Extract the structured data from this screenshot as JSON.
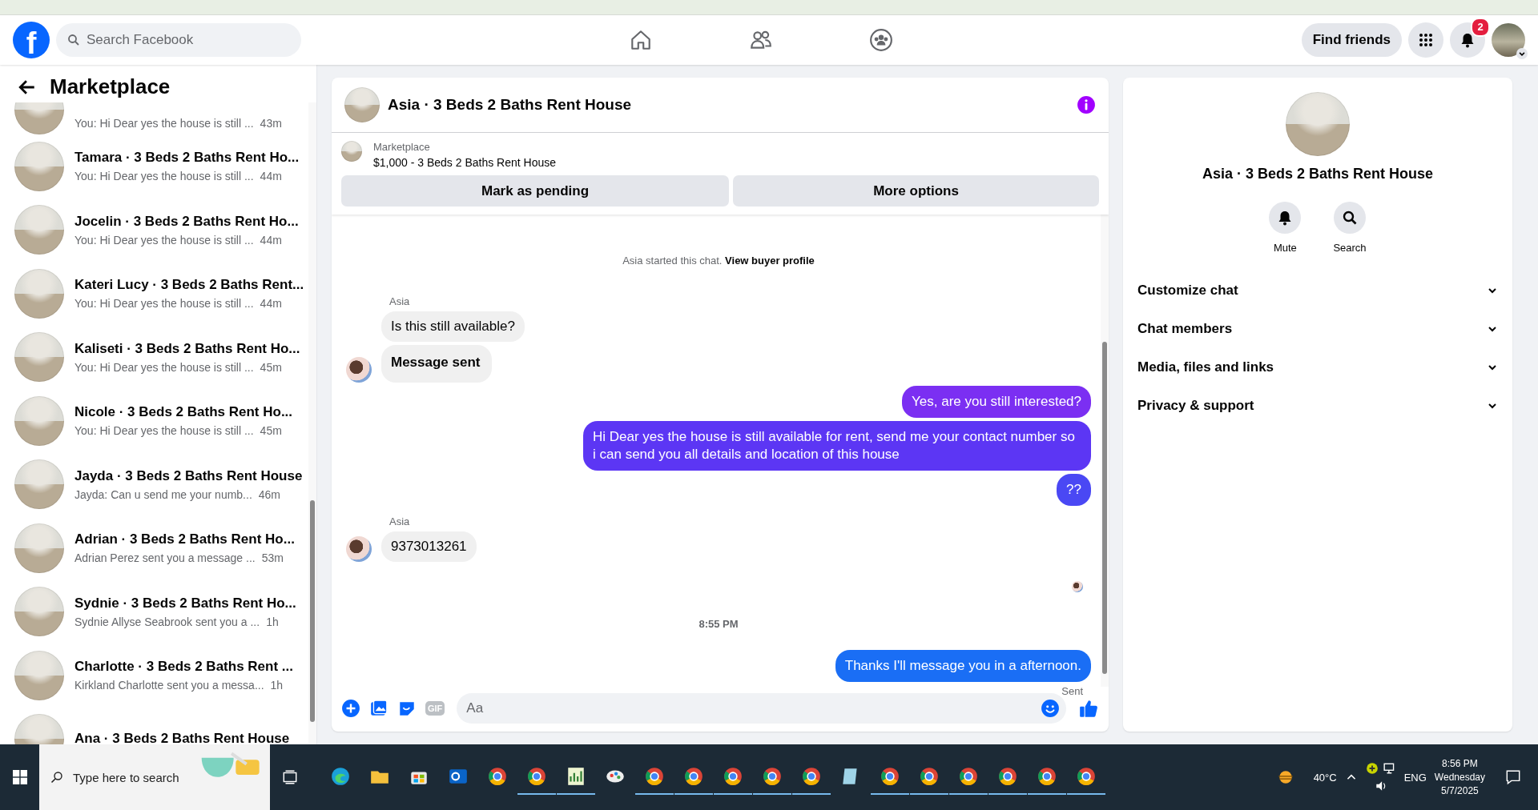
{
  "nav": {
    "logo": "f",
    "search": {
      "placeholder": "Search Facebook"
    },
    "tabs": [
      {
        "kind": "home",
        "selected": false
      },
      {
        "kind": "friends",
        "selected": false
      },
      {
        "kind": "groups",
        "selected": false
      }
    ],
    "find_friends": "Find friends",
    "notifications_badge": "2"
  },
  "sidebar": {
    "title": "Marketplace",
    "items": [
      {
        "preview": "You: Hi Dear yes the house is still ...",
        "time": "43m"
      },
      {
        "name": "Tamara · 3 Beds 2 Baths Rent Ho...",
        "preview": "You: Hi Dear yes the house is still ...",
        "time": "44m"
      },
      {
        "name": "Jocelin · 3 Beds 2 Baths Rent Ho...",
        "preview": "You: Hi Dear yes the house is still ...",
        "time": "44m"
      },
      {
        "name": "Kateri Lucy · 3 Beds 2 Baths Rent...",
        "preview": "You: Hi Dear yes the house is still ...",
        "time": "44m"
      },
      {
        "name": "Kaliseti · 3 Beds 2 Baths Rent Ho...",
        "preview": "You: Hi Dear yes the house is still ...",
        "time": "45m"
      },
      {
        "name": "Nicole · 3 Beds 2 Baths Rent Ho...",
        "preview": "You: Hi Dear yes the house is still ...",
        "time": "45m"
      },
      {
        "name": "Jayda · 3 Beds 2 Baths Rent House",
        "preview": "Jayda: Can u send me your numb...",
        "time": "46m"
      },
      {
        "name": "Adrian · 3 Beds 2 Baths Rent Ho...",
        "preview": "Adrian Perez sent you a message ...",
        "time": "53m"
      },
      {
        "name": "Sydnie · 3 Beds 2 Baths Rent Ho...",
        "preview": "Sydnie Allyse Seabrook sent you a ...",
        "time": "1h"
      },
      {
        "name": "Charlotte · 3 Beds 2 Baths Rent ...",
        "preview": "Kirkland Charlotte sent you a messa...",
        "time": "1h"
      },
      {
        "name": "Ana · 3 Beds 2 Baths Rent House"
      }
    ]
  },
  "chat": {
    "title": "Asia · 3 Beds 2 Baths Rent House",
    "listing": {
      "label": "Marketplace",
      "detail": "$1,000 - 3 Beds 2 Baths Rent House"
    },
    "buttons": [
      "Mark as pending",
      "More options"
    ],
    "messages": [
      {
        "kind": "system",
        "text": "Asia started this chat.",
        "link": "View buyer profile"
      },
      {
        "kind": "sender",
        "text": "Asia"
      },
      {
        "kind": "incoming",
        "text": "Is this still available?",
        "bold": false,
        "avatar": false
      },
      {
        "kind": "incoming",
        "text": "Message sent",
        "bold": true,
        "avatar": true
      },
      {
        "kind": "outgoing",
        "text": "Yes, are you still interested?",
        "color": "#7b2ff2"
      },
      {
        "kind": "outgoing",
        "text": "Hi Dear yes the house is still available for rent, send me your contact number so i can send you all details and location of this house",
        "color": "#5c36f4"
      },
      {
        "kind": "outgoing",
        "text": "??",
        "color": "#4a48f4"
      },
      {
        "kind": "sender",
        "text": "Asia"
      },
      {
        "kind": "incoming",
        "text": "9373013261",
        "bold": false,
        "avatar": true
      },
      {
        "kind": "seen"
      },
      {
        "kind": "time",
        "text": "8:55 PM"
      },
      {
        "kind": "outgoing",
        "text": "Thanks I'll message you in a afternoon.",
        "color": "#1a6ef5"
      },
      {
        "kind": "status",
        "text": "Sent"
      }
    ],
    "composer": {
      "gif": "GIF",
      "placeholder": "Aa"
    }
  },
  "details": {
    "title": "Asia · 3 Beds 2 Baths Rent House",
    "actions": [
      {
        "kind": "mute",
        "label": "Mute"
      },
      {
        "kind": "search",
        "label": "Search"
      }
    ],
    "sections": [
      {
        "label": "Customize chat",
        "expanded": false
      },
      {
        "label": "Chat members",
        "expanded": false
      },
      {
        "label": "Media, files and links",
        "expanded": false
      },
      {
        "label": "Privacy & support",
        "expanded": false
      }
    ]
  },
  "taskbar": {
    "search_placeholder": "Type here to search",
    "apps": [
      {
        "kind": "edge",
        "running": false
      },
      {
        "kind": "folder",
        "running": false
      },
      {
        "kind": "store",
        "running": false
      },
      {
        "kind": "mail",
        "running": false
      },
      {
        "kind": "chrome",
        "running": false
      },
      {
        "kind": "chrome",
        "running": true
      },
      {
        "kind": "sheet",
        "running": true
      },
      {
        "kind": "paint",
        "running": false
      },
      {
        "kind": "chrome",
        "running": true
      },
      {
        "kind": "chrome",
        "running": true
      },
      {
        "kind": "chrome",
        "running": true
      },
      {
        "kind": "chrome",
        "running": true
      },
      {
        "kind": "chrome",
        "running": true
      },
      {
        "kind": "note",
        "running": false
      },
      {
        "kind": "chrome",
        "running": true
      },
      {
        "kind": "chrome",
        "running": true
      },
      {
        "kind": "chrome",
        "running": true
      },
      {
        "kind": "chrome",
        "running": true
      },
      {
        "kind": "chrome",
        "running": true
      },
      {
        "kind": "chrome",
        "running": true
      }
    ],
    "weather": "40°C",
    "language": "ENG",
    "time": "8:56 PM",
    "day": "Wednesday",
    "date": "5/7/2025"
  }
}
